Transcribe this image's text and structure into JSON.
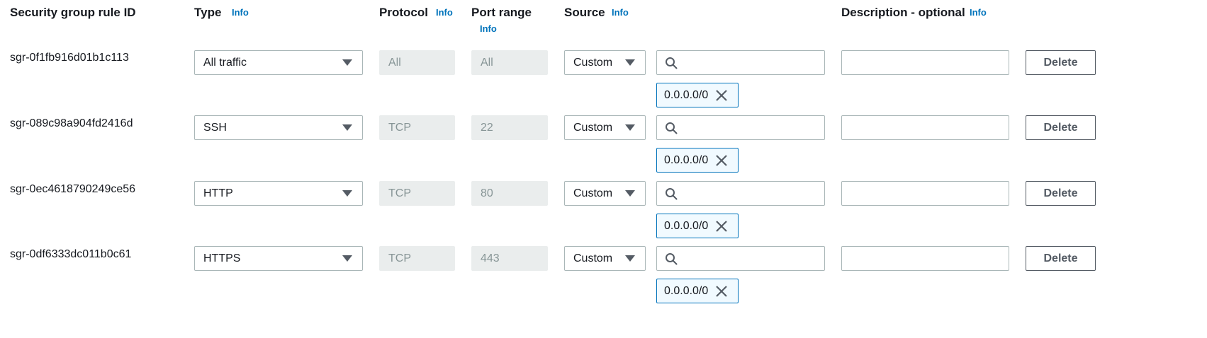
{
  "headers": {
    "rule_id": "Security group rule ID",
    "type": "Type",
    "protocol": "Protocol",
    "port_range": "Port range",
    "source": "Source",
    "description": "Description - optional",
    "info": "Info"
  },
  "rows": [
    {
      "rule_id": "sgr-0f1fb916d01b1c113",
      "type": "All traffic",
      "protocol": "All",
      "port_range": "All",
      "source": "Custom",
      "search": "",
      "cidr": "0.0.0.0/0",
      "description": "",
      "delete": "Delete"
    },
    {
      "rule_id": "sgr-089c98a904fd2416d",
      "type": "SSH",
      "protocol": "TCP",
      "port_range": "22",
      "source": "Custom",
      "search": "",
      "cidr": "0.0.0.0/0",
      "description": "",
      "delete": "Delete"
    },
    {
      "rule_id": "sgr-0ec4618790249ce56",
      "type": "HTTP",
      "protocol": "TCP",
      "port_range": "80",
      "source": "Custom",
      "search": "",
      "cidr": "0.0.0.0/0",
      "description": "",
      "delete": "Delete"
    },
    {
      "rule_id": "sgr-0df6333dc011b0c61",
      "type": "HTTPS",
      "protocol": "TCP",
      "port_range": "443",
      "source": "Custom",
      "search": "",
      "cidr": "0.0.0.0/0",
      "description": "",
      "delete": "Delete"
    }
  ],
  "icons": {
    "search": "search-icon",
    "remove": "close-icon",
    "dropdown": "caret-down-icon"
  },
  "colors": {
    "info_link": "#0073bb",
    "token_border": "#0073bb",
    "disabled_bg": "#eaeded"
  }
}
